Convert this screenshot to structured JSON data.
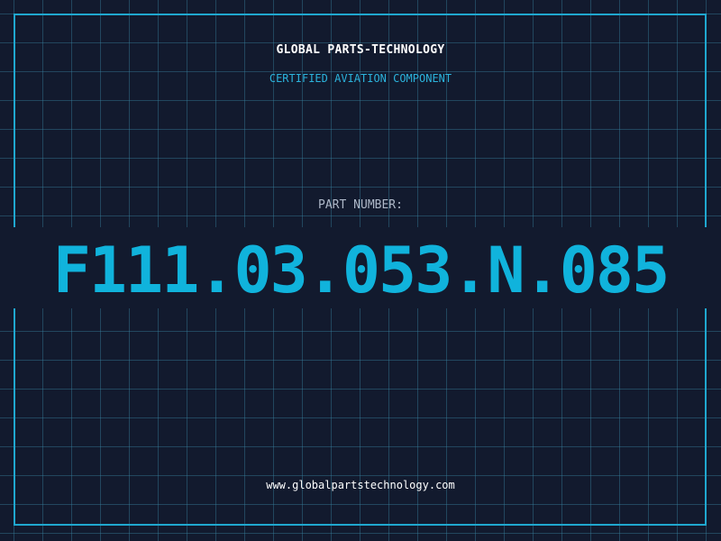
{
  "header": {
    "title": "GLOBAL PARTS-TECHNOLOGY",
    "subtitle": "CERTIFIED AVIATION COMPONENT"
  },
  "part": {
    "label": "PART NUMBER:",
    "number": "F111.03.053.N.085"
  },
  "footer": {
    "website": "www.globalpartstechnology.com"
  },
  "colors": {
    "background": "#121a2e",
    "grid": "#2a5f78",
    "frame": "#1fa7cf",
    "accent": "#10b3dc",
    "subtitle": "#2bb3dc",
    "label": "#aeb8c8"
  }
}
